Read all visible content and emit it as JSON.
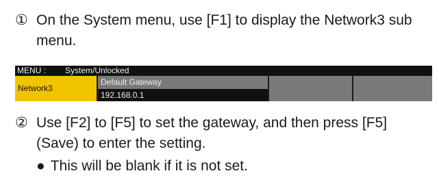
{
  "steps": [
    {
      "num": "①",
      "text": "On the System menu, use [F1] to display the Network3 sub menu."
    },
    {
      "num": "②",
      "text": "Use [F2] to [F5] to set the gateway, and then press [F5] (Save) to enter the setting."
    }
  ],
  "bullet": {
    "symbol": "●",
    "text": "This will be blank if it is not set."
  },
  "menu": {
    "label": "MENU :",
    "path": "System/Unlocked",
    "submenu": "Network3",
    "field_title": "Default Gateway",
    "field_value": "192.168.0.1",
    "colors": {
      "accent": "#f2c400",
      "cell": "#7a7a7a",
      "value_bg": "#101010",
      "header_bg": "#111111"
    }
  }
}
